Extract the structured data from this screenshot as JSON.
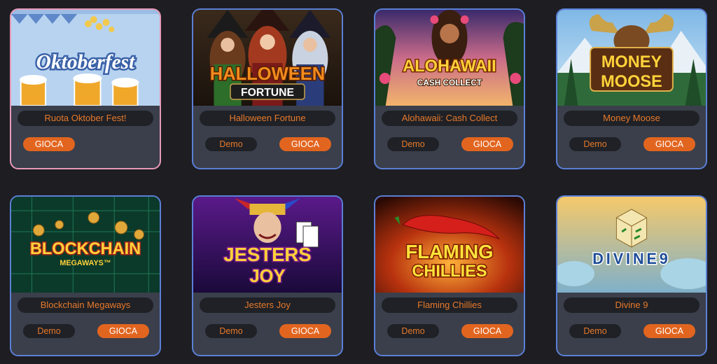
{
  "colors": {
    "background": "#1d1d22",
    "card": "#3a3f4b",
    "card_border": "#5b7fd6",
    "accent": "#e2651f",
    "text_orange": "#e8792a"
  },
  "games": [
    {
      "title": "Ruota Oktober Fest!",
      "logo": "Oktoberfest",
      "play": "GIOCA",
      "highlight": true
    },
    {
      "title": "Halloween Fortune",
      "logo": "HALLOWEEN",
      "logo2": "FORTUNE",
      "demo": "Demo",
      "play": "GIOCA"
    },
    {
      "title": "Alohawaii: Cash Collect",
      "logo": "ALOHAWAII",
      "logo2": "CASH COLLECT",
      "demo": "Demo",
      "play": "GIOCA"
    },
    {
      "title": "Money Moose",
      "logo": "MONEY",
      "logo2": "MOOSE",
      "demo": "Demo",
      "play": "GIOCA"
    },
    {
      "title": "Blockchain Megaways",
      "logo": "BLOCKCHAIN",
      "logo2": "MEGAWAYS™",
      "demo": "Demo",
      "play": "GIOCA"
    },
    {
      "title": "Jesters Joy",
      "logo": "JESTERS",
      "logo2": "JOY",
      "demo": "Demo",
      "play": "GIOCA"
    },
    {
      "title": "Flaming Chillies",
      "logo": "FLAMING",
      "logo2": "CHILLIES",
      "demo": "Demo",
      "play": "GIOCA"
    },
    {
      "title": "Divine 9",
      "logo": "DIVINE9",
      "demo": "Demo",
      "play": "GIOCA"
    }
  ]
}
